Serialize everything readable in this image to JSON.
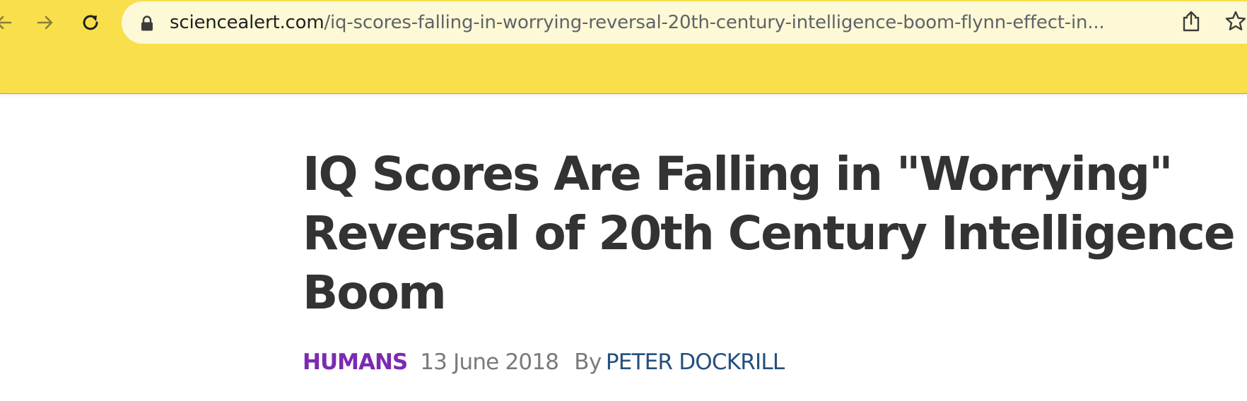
{
  "browser": {
    "url_domain": "sciencealert.com",
    "url_path": "/iq-scores-falling-in-worrying-reversal-20th-century-intelligence-boom-flynn-effect-in...",
    "icons": [
      "back-arrow-icon",
      "forward-arrow-icon",
      "reload-icon",
      "lock-icon",
      "share-icon",
      "star-icon"
    ],
    "chrome_color": "#f9df4b"
  },
  "article": {
    "headline": "IQ Scores Are Falling in \"Worrying\" Reversal of 20th Century Intelligence Boom",
    "category": "HUMANS",
    "date": "13 June 2018",
    "by": "By",
    "author": "PETER DOCKRILL",
    "colors": {
      "headline": "#333333",
      "category": "#7b2ab1",
      "author": "#25507d"
    }
  }
}
